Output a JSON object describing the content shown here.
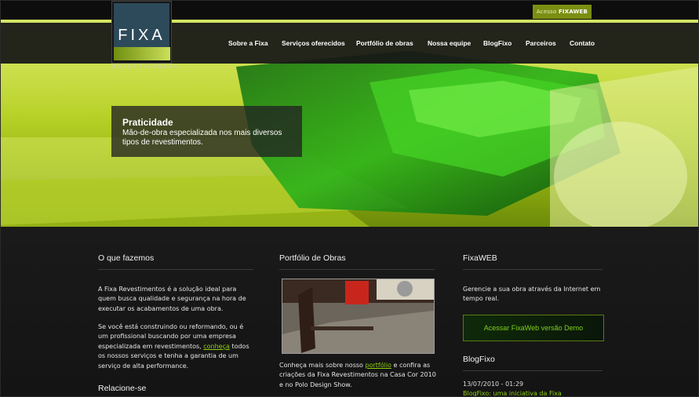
{
  "top": {
    "access_prefix": "Acesso",
    "access_brand": "FIXAWEB"
  },
  "logo": {
    "name": "FIXA",
    "sub": "REVESTIMENTOS"
  },
  "nav": {
    "items": [
      "Sobre a Fixa",
      "Serviços oferecidos",
      "Portfólio de obras",
      "Nossa equipe",
      "BlogFixo",
      "Parceiros",
      "Contato"
    ]
  },
  "hero": {
    "title": "Praticidade",
    "text": "Mão-de-obra especializada nos mais diversos tipos de revestimentos."
  },
  "col1": {
    "heading": "O que fazemos",
    "p1": "A Fixa Revestimentos é a solução ideal para quem busca qualidade e segurança na hora de executar os acabamentos de uma obra.",
    "p2_before": "Se você está construindo ou reformando, ou é um profissional buscando por uma empresa especializada em revestimentos, ",
    "p2_link": "conheça",
    "p2_after": " todos os nossos serviços e tenha a garantia de um serviço de alta performance.",
    "heading2": "Relacione-se"
  },
  "col2": {
    "heading": "Portfólio de Obras",
    "text_before": "Conheça mais sobre nosso ",
    "text_link": "portfólio",
    "text_after": " e confira as criações da Fixa Revestimentos na Casa Cor 2010 e no Polo Design Show."
  },
  "col3": {
    "heading": "FixaWEB",
    "text": "Gerencie a sua obra através da Internet em tempo real.",
    "button": "Acessar FixaWeb versão Demo",
    "heading2": "BlogFixo",
    "date": "13/07/2010 - 01:29",
    "post": "BlogFixo: uma iniciativa da Fixa"
  },
  "colors": {
    "accent": "#8ed10c",
    "hero_lime": "#b9d70f",
    "dark": "#141414"
  }
}
